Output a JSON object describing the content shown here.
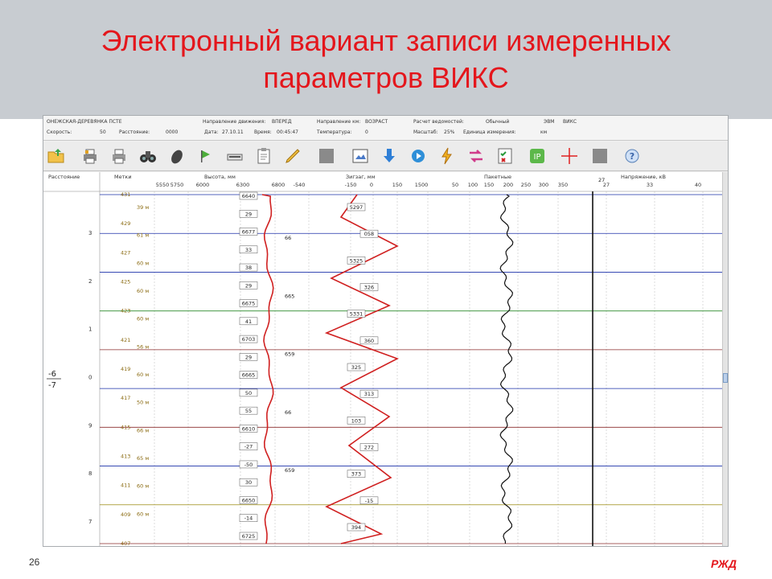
{
  "slide": {
    "title_line1": "Электронный вариант записи измеренных",
    "title_line2": "параметров ВИКС",
    "page_number": "26",
    "logo_text": "РЖД"
  },
  "info_bar": {
    "row1": [
      "ОНЕЖСКАЯ-ДЕРЕВЯНКА ПСТЕ",
      "Направление движения:",
      "ВПЕРЕД",
      "Направление км:",
      "ВОЗРАСТ",
      "Расчет ведомостей:",
      "Обычный",
      "ЭВМ",
      "ВИКС"
    ],
    "row2": [
      "Скорость:",
      "50",
      "Расстояние:",
      "0000",
      "Дата:",
      "27.10.11",
      "Время:",
      "00:45:47",
      "Температура:",
      "0",
      "Масштаб:",
      "25%",
      "Единица измерения:",
      "км"
    ]
  },
  "toolbar": {
    "buttons": [
      {
        "name": "open-folder-icon"
      },
      {
        "name": "printer-color-icon"
      },
      {
        "name": "printer-icon"
      },
      {
        "name": "binoculars-icon"
      },
      {
        "name": "mouse-icon"
      },
      {
        "name": "flag-icon"
      },
      {
        "name": "scanner-icon"
      },
      {
        "name": "clipboard-icon"
      },
      {
        "name": "pencil-icon"
      },
      {
        "name": "gray-square-icon"
      },
      {
        "name": "image-frame-icon"
      },
      {
        "name": "arrow-down-icon"
      },
      {
        "name": "play-circle-icon"
      },
      {
        "name": "lightning-icon"
      },
      {
        "name": "swap-arrows-icon"
      },
      {
        "name": "checklist-icon"
      },
      {
        "name": "ip-settings-icon"
      },
      {
        "name": "crosshair-icon"
      },
      {
        "name": "gray-square-icon-2"
      },
      {
        "name": "help-icon"
      }
    ],
    "ip_label": "IP"
  },
  "chart_data": {
    "type": "line",
    "column_headers": [
      "Расстояние",
      "Метки",
      "Высота, мм",
      "Зигзаг, мм",
      "Пакетные",
      "Напряжение, кВ"
    ],
    "height_axis_ticks": [
      "5550",
      "5750",
      "6000",
      "6300",
      "6800"
    ],
    "zigzag_axis_ticks": [
      "-540",
      "-150",
      "0",
      "150",
      "1500"
    ],
    "packet_axis_ticks": [
      "50",
      "100",
      "150",
      "200",
      "250",
      "300",
      "350"
    ],
    "voltage_axis_ticks": [
      "27",
      "33",
      "40"
    ],
    "distance_ticks": [
      "3",
      "2",
      "1",
      "0",
      "9",
      "8",
      "7"
    ],
    "side_label_top": "-6",
    "side_label_bottom": "-7",
    "pillar_labels": [
      "431",
      "429",
      "427",
      "425",
      "423",
      "421",
      "419",
      "417",
      "415",
      "413",
      "411",
      "409",
      "407"
    ],
    "span_labels": [
      "39 м",
      "61 м",
      "60 м",
      "60 м",
      "60 м",
      "56 м",
      "60 м",
      "50 м",
      "66 м",
      "65 м",
      "60 м",
      "60 м"
    ],
    "km_lines": [
      {
        "label": "431",
        "color": "blue"
      },
      {
        "label": "427",
        "color": "blue"
      },
      {
        "label": "423",
        "color": "blue"
      },
      {
        "label": "419",
        "color": "green"
      },
      {
        "label": "417",
        "color": "brown"
      },
      {
        "label": "415",
        "color": "blue"
      },
      {
        "label": "413",
        "color": "brown"
      },
      {
        "label": "411",
        "color": "blue"
      },
      {
        "label": "409",
        "color": "olive"
      },
      {
        "label": "407",
        "color": "brown"
      }
    ],
    "height_box_labels": [
      "6640",
      "29",
      "6677",
      "33",
      "38",
      "29",
      "6675",
      "41",
      "6703",
      "29",
      "6665",
      "50",
      "55",
      "6610",
      "-27",
      "-50",
      "30",
      "6650",
      "-14",
      "6725"
    ],
    "height_side_labels": [
      "66",
      "665",
      "659",
      "66",
      "659"
    ],
    "zigzag_box_labels": [
      "5297",
      "058",
      "5325",
      "326",
      "5331",
      "360",
      "325",
      "313",
      "103",
      "272",
      "373",
      "-15",
      "394"
    ],
    "voltage_value": "27"
  }
}
